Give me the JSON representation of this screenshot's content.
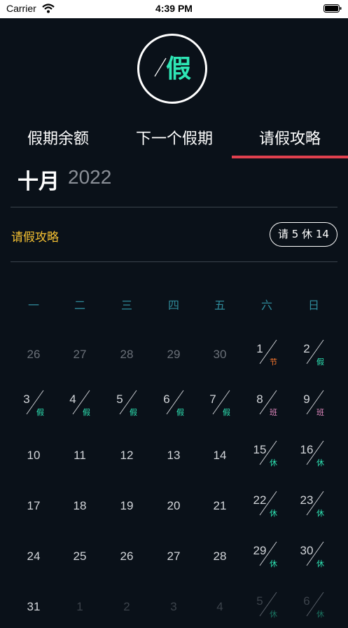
{
  "status_bar": {
    "carrier": "Carrier",
    "time": "4:39 PM"
  },
  "logo": {
    "char": "假"
  },
  "tabs": [
    {
      "label": "假期余额"
    },
    {
      "label": "下一个假期"
    },
    {
      "label": "请假攻略",
      "selected": true
    }
  ],
  "month": {
    "name": "十月",
    "year": "2022"
  },
  "strategy": {
    "label": "请假攻略",
    "badge": "请 5 休 14"
  },
  "weekdays": [
    "一",
    "二",
    "三",
    "四",
    "五",
    "六",
    "日"
  ],
  "days": [
    {
      "num": "26",
      "tone": "dim",
      "tag": ""
    },
    {
      "num": "27",
      "tone": "dim",
      "tag": ""
    },
    {
      "num": "28",
      "tone": "dim",
      "tag": ""
    },
    {
      "num": "29",
      "tone": "dim",
      "tag": ""
    },
    {
      "num": "30",
      "tone": "dim",
      "tag": ""
    },
    {
      "num": "1",
      "tone": "light",
      "tag": "节",
      "tag_type": "jie"
    },
    {
      "num": "2",
      "tone": "light",
      "tag": "假",
      "tag_type": "jia"
    },
    {
      "num": "3",
      "tone": "light",
      "tag": "假",
      "tag_type": "jia"
    },
    {
      "num": "4",
      "tone": "light",
      "tag": "假",
      "tag_type": "jia"
    },
    {
      "num": "5",
      "tone": "light",
      "tag": "假",
      "tag_type": "jia"
    },
    {
      "num": "6",
      "tone": "light",
      "tag": "假",
      "tag_type": "jia"
    },
    {
      "num": "7",
      "tone": "light",
      "tag": "假",
      "tag_type": "jia"
    },
    {
      "num": "8",
      "tone": "light",
      "tag": "班",
      "tag_type": "ban"
    },
    {
      "num": "9",
      "tone": "light",
      "tag": "班",
      "tag_type": "ban"
    },
    {
      "num": "10",
      "tone": "light",
      "tag": ""
    },
    {
      "num": "11",
      "tone": "light",
      "tag": ""
    },
    {
      "num": "12",
      "tone": "light",
      "tag": ""
    },
    {
      "num": "13",
      "tone": "light",
      "tag": ""
    },
    {
      "num": "14",
      "tone": "light",
      "tag": ""
    },
    {
      "num": "15",
      "tone": "light",
      "tag": "休",
      "tag_type": "xiu"
    },
    {
      "num": "16",
      "tone": "light",
      "tag": "休",
      "tag_type": "xiu"
    },
    {
      "num": "17",
      "tone": "light",
      "tag": ""
    },
    {
      "num": "18",
      "tone": "light",
      "tag": ""
    },
    {
      "num": "19",
      "tone": "light",
      "tag": ""
    },
    {
      "num": "20",
      "tone": "light",
      "tag": ""
    },
    {
      "num": "21",
      "tone": "light",
      "tag": ""
    },
    {
      "num": "22",
      "tone": "light",
      "tag": "休",
      "tag_type": "xiu"
    },
    {
      "num": "23",
      "tone": "light",
      "tag": "休",
      "tag_type": "xiu"
    },
    {
      "num": "24",
      "tone": "light",
      "tag": ""
    },
    {
      "num": "25",
      "tone": "light",
      "tag": ""
    },
    {
      "num": "26",
      "tone": "light",
      "tag": ""
    },
    {
      "num": "27",
      "tone": "light",
      "tag": ""
    },
    {
      "num": "28",
      "tone": "light",
      "tag": ""
    },
    {
      "num": "29",
      "tone": "light",
      "tag": "休",
      "tag_type": "xiu"
    },
    {
      "num": "30",
      "tone": "light",
      "tag": "休",
      "tag_type": "xiu"
    },
    {
      "num": "31",
      "tone": "light",
      "tag": ""
    },
    {
      "num": "1",
      "tone": "faded",
      "tag": ""
    },
    {
      "num": "2",
      "tone": "faded",
      "tag": ""
    },
    {
      "num": "3",
      "tone": "faded",
      "tag": ""
    },
    {
      "num": "4",
      "tone": "faded",
      "tag": ""
    },
    {
      "num": "5",
      "tone": "faded",
      "tag": "休",
      "tag_type": "xiu"
    },
    {
      "num": "6",
      "tone": "faded",
      "tag": "休",
      "tag_type": "xiu"
    }
  ],
  "colors": {
    "background": "#0a1119",
    "accent_green": "#2ee6b5",
    "tab_underline": "#e0404e",
    "strategy_yellow": "#f5c132",
    "weekday_teal": "#2f8a9a",
    "tag_jie": "#ff7a2e",
    "tag_ban": "#e58bc2"
  }
}
